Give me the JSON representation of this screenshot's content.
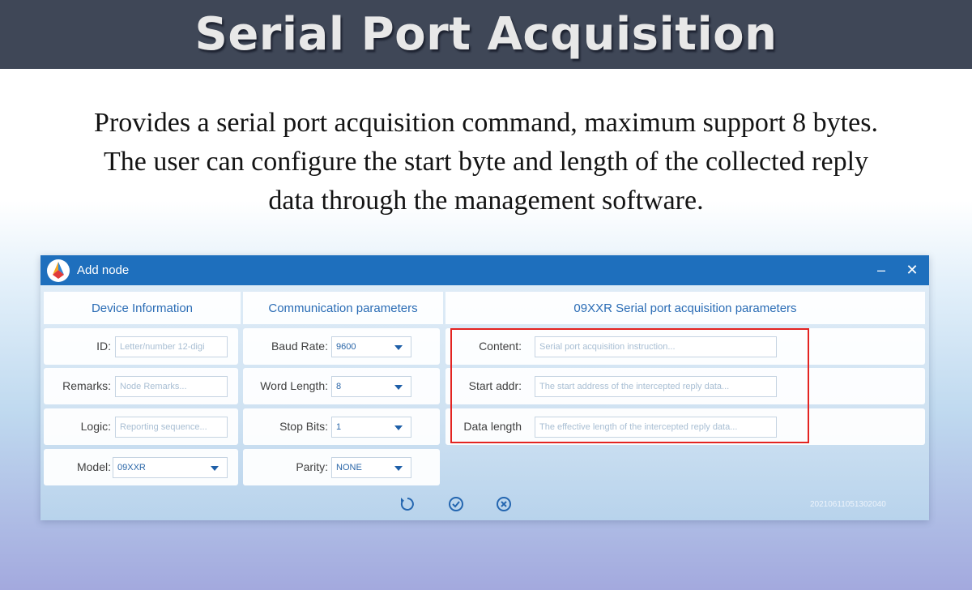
{
  "banner": {
    "title": "Serial Port Acquisition"
  },
  "description": {
    "line1": "Provides a serial port acquisition command, maximum support 8 bytes.",
    "line2": "The user can configure the start byte and length of the collected reply",
    "line3": "data through the management software."
  },
  "window": {
    "title": "Add node",
    "minimize_symbol": "–",
    "close_symbol": "✕",
    "serial_number": "20210611051302040"
  },
  "device_info": {
    "header": "Device Information",
    "id": {
      "label": "ID:",
      "placeholder": "Letter/number 12-digi"
    },
    "remarks": {
      "label": "Remarks:",
      "placeholder": "Node Remarks..."
    },
    "logic": {
      "label": "Logic:",
      "placeholder": "Reporting sequence..."
    },
    "model": {
      "label": "Model:",
      "value": "09XXR"
    }
  },
  "comm_params": {
    "header": "Communication parameters",
    "baud_rate": {
      "label": "Baud Rate:",
      "value": "9600"
    },
    "word_length": {
      "label": "Word Length:",
      "value": "8"
    },
    "stop_bits": {
      "label": "Stop Bits:",
      "value": "1"
    },
    "parity": {
      "label": "Parity:",
      "value": "NONE"
    }
  },
  "acquisition": {
    "header": "09XXR Serial port acquisition parameters",
    "content": {
      "label": "Content:",
      "placeholder": "Serial port acquisition instruction..."
    },
    "start_addr": {
      "label": "Start addr:",
      "placeholder": "The start address of the intercepted reply data..."
    },
    "data_length": {
      "label": "Data length",
      "placeholder": "The effective length of the intercepted reply data..."
    }
  },
  "icons": {
    "app": "app-logo-icon",
    "reset": "refresh-icon",
    "confirm": "check-circle-icon",
    "cancel": "x-circle-icon"
  },
  "colors": {
    "banner_bg": "#3f4757",
    "titlebar": "#1e6fbd",
    "header_text": "#2a6cb5",
    "highlight": "#e32421"
  }
}
